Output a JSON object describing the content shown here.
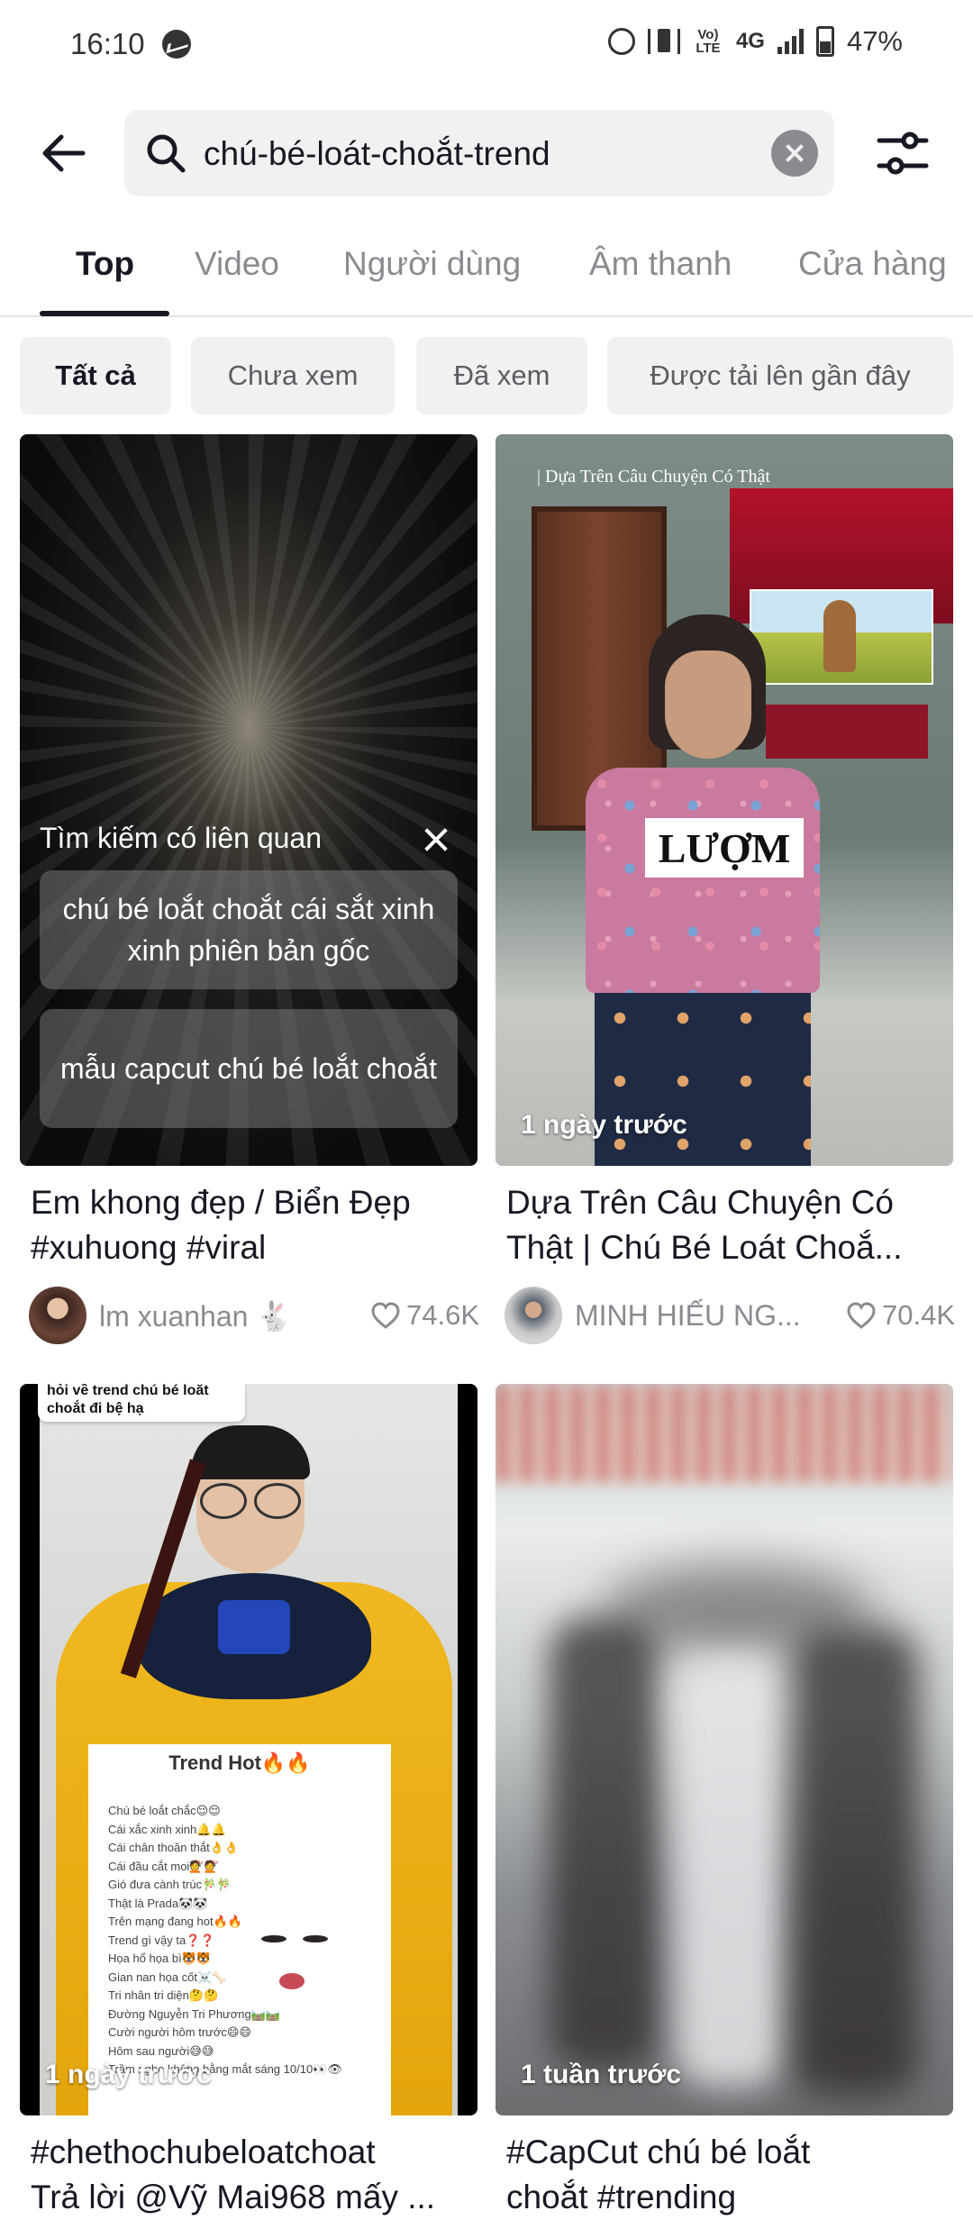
{
  "status_bar": {
    "time": "16:10",
    "network": "4G",
    "volte": "Vo) LTE",
    "battery": "47%"
  },
  "search": {
    "query": "chú-bé-loát-choắt-trend"
  },
  "tabs": [
    {
      "label": "Top",
      "active": true
    },
    {
      "label": "Video",
      "active": false
    },
    {
      "label": "Người dùng",
      "active": false
    },
    {
      "label": "Âm thanh",
      "active": false
    },
    {
      "label": "Cửa hàng",
      "active": false
    }
  ],
  "filters": [
    {
      "label": "Tất cả",
      "active": true
    },
    {
      "label": "Chưa xem",
      "active": false
    },
    {
      "label": "Đã xem",
      "active": false
    },
    {
      "label": "Được tải lên gần đây",
      "active": false
    }
  ],
  "related_search": {
    "title": "Tìm kiếm có liên quan",
    "suggestions": [
      "chú bé loắt choắt cái sắt xinh xinh phiên bản gốc",
      "mẫu capcut chú bé loắt choắt"
    ]
  },
  "videos": [
    {
      "title_line1": "Em khong đẹp / Biển Đẹp",
      "title_line2": "#xuhuong #viral",
      "author": "lm xuanhan 🐇",
      "likes": "74.6K",
      "time_ago": ""
    },
    {
      "title_line1": "Dựa Trên Câu Chuyện Có",
      "title_line2": "Thật | Chú Bé Loát Choắ...",
      "author": "MINH HIẾU NG...",
      "likes": "70.4K",
      "time_ago": "1 ngày trước",
      "overlay_caption": "| Dựa Trên Câu Chuyện Có Thật",
      "overlay_label": "LƯỢM"
    },
    {
      "title_line1": "#chethochubeloatchoat",
      "title_line2": "Trả lời @Vỹ Mai968 mấy ...",
      "time_ago": "1 ngày trước",
      "bubble_text": "hỏi về trend chú bé loắt choắt đi bệ hạ",
      "panel_title": "Trend Hot🔥🔥",
      "panel_lines": [
        "Chú bé loắt chắc😌😌",
        "Cái xắc xinh xinh🔔🔔",
        "Cái chân thoăn thắt👌👌",
        "Cái đầu cắt moi💇💇",
        "Gió đưa cành trúc🎋🎋",
        "Thật là Prada🐼🐼",
        "Trên mạng đang hot🔥🔥",
        "Trend gì vậy ta❓❓",
        "Họa hổ họa bì🐯🐯",
        "Gian nan họa cốt☠️🦴",
        "Tri nhân tri diện🤔🤔",
        "Đường Nguyễn Tri Phương🛤️🛤️",
        "Cười người hôm trước😄😄",
        "Hôm sau người😅😅",
        "Trầm nghe không bằng mắt sáng 10/10👀👁"
      ]
    },
    {
      "title_line1": "#CapCut chú bé loắt",
      "title_line2": "choắt #trending",
      "time_ago": "1 tuần trước"
    }
  ]
}
